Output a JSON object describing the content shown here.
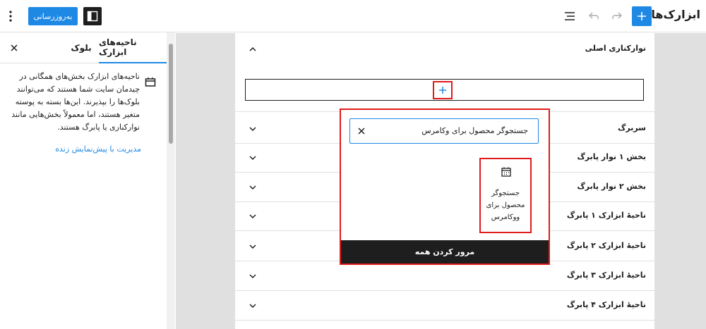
{
  "header": {
    "title": "ابزارک‌ها",
    "update_label": "به‌روزرسانی"
  },
  "sidebar": {
    "tabs": [
      {
        "label": "ناحیه‌های ابزارک",
        "active": true
      },
      {
        "label": "بلوک",
        "active": false
      }
    ],
    "description": "ناحیه‌های ابزارک بخش‌های همگانی در چیدمان سایت شما هستند که می‌توانند بلوک‌ها را بپذیرند. این‌ها بسته به پوسته متغیر هستند، اما معمولاً بخش‌هایی مانند نوارکناری یا پابرگ هستند.",
    "link": "مدیریت با پیش‌نمایش زنده"
  },
  "widget_areas": [
    {
      "label": "نوارکناری اصلی",
      "expanded": true
    },
    {
      "label": "سربرگ",
      "expanded": false
    },
    {
      "label": "بخش ۱ نوار پابرگ",
      "expanded": false
    },
    {
      "label": "بخش ۲ نوار پابرگ",
      "expanded": false
    },
    {
      "label": "ناحیهٔ ابزارک ۱ پابرگ",
      "expanded": false
    },
    {
      "label": "ناحیهٔ ابزارک ۲ پابرگ",
      "expanded": false
    },
    {
      "label": "ناحیهٔ ابزارک ۳ پابرگ",
      "expanded": false
    },
    {
      "label": "ناحیهٔ ابزارک ۴ پابرگ",
      "expanded": false
    }
  ],
  "inserter": {
    "search_value": "جستجوگر محصول برای وکامرس",
    "result": {
      "label": "جستجوگر محصول برای ووکامرس",
      "icon": "calendar-icon"
    },
    "browse_all_label": "مرور کردن همه"
  },
  "colors": {
    "accent": "#1e88e5",
    "highlight": "#e01b1b",
    "dark": "#1e1e1e"
  }
}
